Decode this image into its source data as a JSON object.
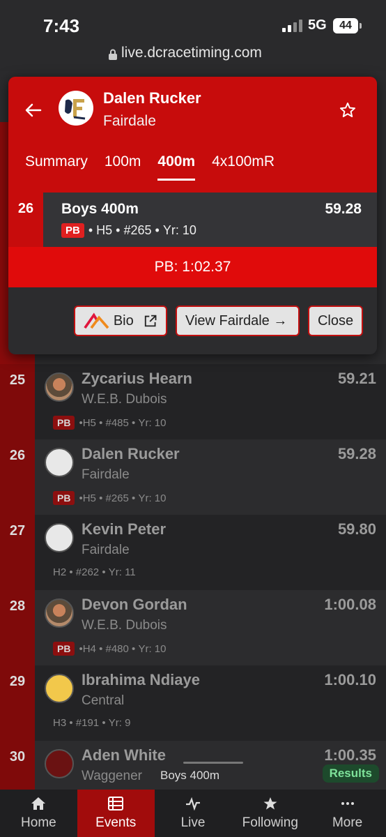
{
  "status": {
    "time": "7:43",
    "network": "5G",
    "battery": "44"
  },
  "browser": {
    "url": "live.dcracetiming.com"
  },
  "modal": {
    "athlete_name": "Dalen Rucker",
    "school": "Fairdale",
    "tabs": [
      {
        "label": "Summary",
        "active": false
      },
      {
        "label": "100m",
        "active": false
      },
      {
        "label": "400m",
        "active": true
      },
      {
        "label": "4x100mR",
        "active": false
      }
    ],
    "result": {
      "place": "26",
      "event": "Boys 400m",
      "mark": "59.28",
      "pb_badge": "PB",
      "heat": "H5",
      "bib": "#265",
      "year": "Yr: 10"
    },
    "pb_text": "PB: 1:02.37",
    "buttons": {
      "bio": "Bio",
      "view_team": "View Fairdale →",
      "close": "Close"
    }
  },
  "rows": [
    {
      "place": "25",
      "name": "Zycarius Hearn",
      "team": "W.E.B. Dubois",
      "mark": "59.21",
      "pb": "PB",
      "heat": "H5",
      "bib": "#485",
      "year": "Yr: 10",
      "avatar": "web-dubois-logo"
    },
    {
      "place": "26",
      "name": "Dalen Rucker",
      "team": "Fairdale",
      "mark": "59.28",
      "pb": "PB",
      "heat": "H5",
      "bib": "#265",
      "year": "Yr: 10",
      "avatar": "fairdale-logo"
    },
    {
      "place": "27",
      "name": "Kevin Peter",
      "team": "Fairdale",
      "mark": "59.80",
      "pb": "",
      "heat": "H2",
      "bib": "#262",
      "year": "Yr: 11",
      "avatar": "fairdale-logo"
    },
    {
      "place": "28",
      "name": "Devon Gordan",
      "team": "W.E.B. Dubois",
      "mark": "1:00.08",
      "pb": "PB",
      "heat": "H4",
      "bib": "#480",
      "year": "Yr: 10",
      "avatar": "web-dubois-logo"
    },
    {
      "place": "29",
      "name": "Ibrahima Ndiaye",
      "team": "Central",
      "mark": "1:00.10",
      "pb": "",
      "heat": "H3",
      "bib": "#191",
      "year": "Yr: 9",
      "avatar": "central-logo"
    },
    {
      "place": "30",
      "name": "Aden White",
      "team": "Waggener",
      "mark": "1:00.35",
      "pb": "",
      "heat": "",
      "bib": "",
      "year": "",
      "avatar": "waggener-logo"
    }
  ],
  "minibar": {
    "event": "Boys 400m",
    "results": "Results"
  },
  "nav": [
    {
      "label": "Home",
      "icon": "home-icon",
      "active": false
    },
    {
      "label": "Events",
      "icon": "list-icon",
      "active": true
    },
    {
      "label": "Live",
      "icon": "pulse-icon",
      "active": false
    },
    {
      "label": "Following",
      "icon": "star-icon",
      "active": false
    },
    {
      "label": "More",
      "icon": "more-icon",
      "active": false
    }
  ],
  "colors": {
    "accent_red": "#c70c0c",
    "pb_bar": "#e00b0b",
    "results_green": "#7ee29a"
  }
}
